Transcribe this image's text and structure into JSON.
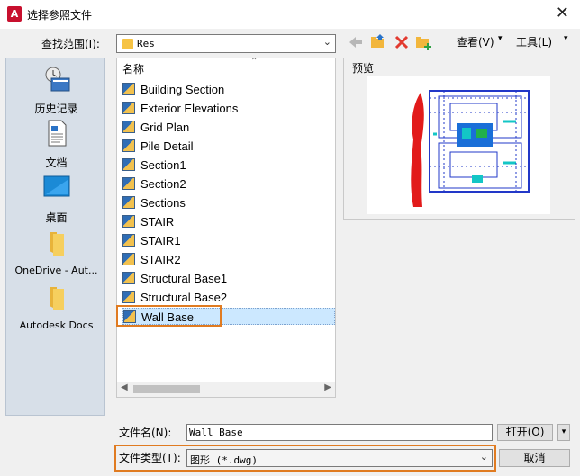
{
  "window": {
    "title": "选择参照文件",
    "app_icon_letter": "A"
  },
  "lookin": {
    "label": "查找范围(I):",
    "value": "Res"
  },
  "toolbar": {
    "view_label": "查看(V)",
    "tools_label": "工具(L)"
  },
  "places": [
    {
      "label": "历史记录",
      "icon": "history-icon"
    },
    {
      "label": "文档",
      "icon": "document-icon"
    },
    {
      "label": "桌面",
      "icon": "desktop-icon"
    },
    {
      "label": "OneDrive - Aut...",
      "icon": "folder-icon"
    },
    {
      "label": "Autodesk Docs",
      "icon": "folder-icon"
    }
  ],
  "filelist": {
    "column_header": "名称",
    "files": [
      "Building Section",
      "Exterior Elevations",
      "Grid Plan",
      "Pile Detail",
      "Section1",
      "Section2",
      "Sections",
      "STAIR",
      "STAIR1",
      "STAIR2",
      "Structural Base1",
      "Structural Base2",
      "Wall Base"
    ],
    "selected": "Wall Base"
  },
  "preview": {
    "label": "预览"
  },
  "filename": {
    "label": "文件名(N):",
    "value": "Wall Base"
  },
  "filetype": {
    "label": "文件类型(T):",
    "value": "图形 (*.dwg)"
  },
  "buttons": {
    "open": "打开(O)",
    "cancel": "取消"
  },
  "colors": {
    "highlight": "#e07b21",
    "selection": "#cce8ff",
    "places_bg": "#d7dfe8"
  }
}
